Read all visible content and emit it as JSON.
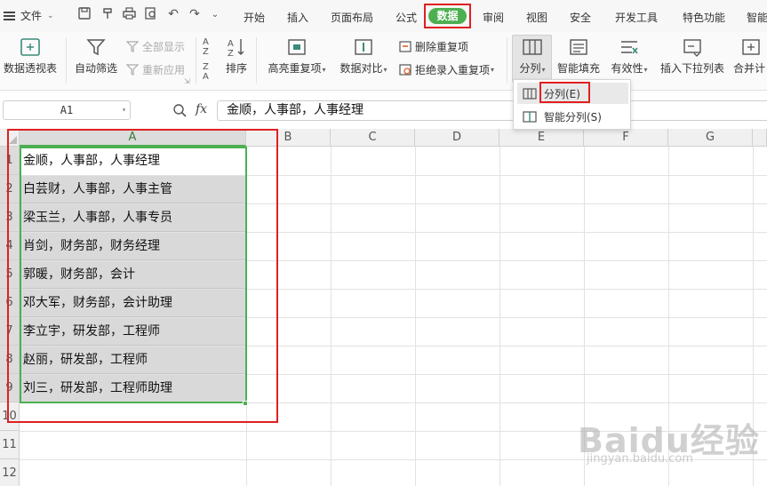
{
  "menubar": {
    "file_label": "文件",
    "tabs": [
      "开始",
      "插入",
      "页面布局",
      "公式",
      "数据",
      "审阅",
      "视图",
      "安全",
      "开发工具",
      "特色功能",
      "智能"
    ],
    "active_tab": "数据",
    "active_color": "#4caf50",
    "highlight_color": "#e02020"
  },
  "ribbon": {
    "pivot_table": "数据透视表",
    "auto_filter": "自动筛选",
    "show_all": "全部显示",
    "reapply": "重新应用",
    "sort": "排序",
    "highlight_dup": "高亮重复项",
    "data_compare": "数据对比",
    "remove_dup": "删除重复项",
    "reject_dup": "拒绝录入重复项",
    "split_column": "分列",
    "smart_fill": "智能填充",
    "validity": "有效性",
    "insert_dropdown": "插入下拉列表",
    "merge_calc": "合并计"
  },
  "dropdown": {
    "items": [
      {
        "label": "分列(E)"
      },
      {
        "label": "智能分列(S)"
      }
    ]
  },
  "formulabar": {
    "cell_ref": "A1",
    "fx_label": "fx",
    "formula": "金顺，人事部，人事经理"
  },
  "grid": {
    "columns": [
      "A",
      "B",
      "C",
      "D",
      "E",
      "F",
      "G"
    ],
    "rows": [
      "1",
      "2",
      "3",
      "4",
      "5",
      "6",
      "7",
      "8",
      "9",
      "10",
      "11",
      "12"
    ],
    "cells_A": [
      "金顺，人事部，人事经理",
      "白芸财，人事部，人事主管",
      "梁玉兰，人事部，人事专员",
      "肖剑，财务部，财务经理",
      "郭暖，财务部，会计",
      "邓大军，财务部，会计助理",
      "李立宇，研发部，工程师",
      "赵丽，研发部，工程师",
      "刘三，研发部，工程师助理"
    ]
  },
  "watermark": {
    "brand": "Baidu经验",
    "url": "jingyan.baidu.com"
  }
}
